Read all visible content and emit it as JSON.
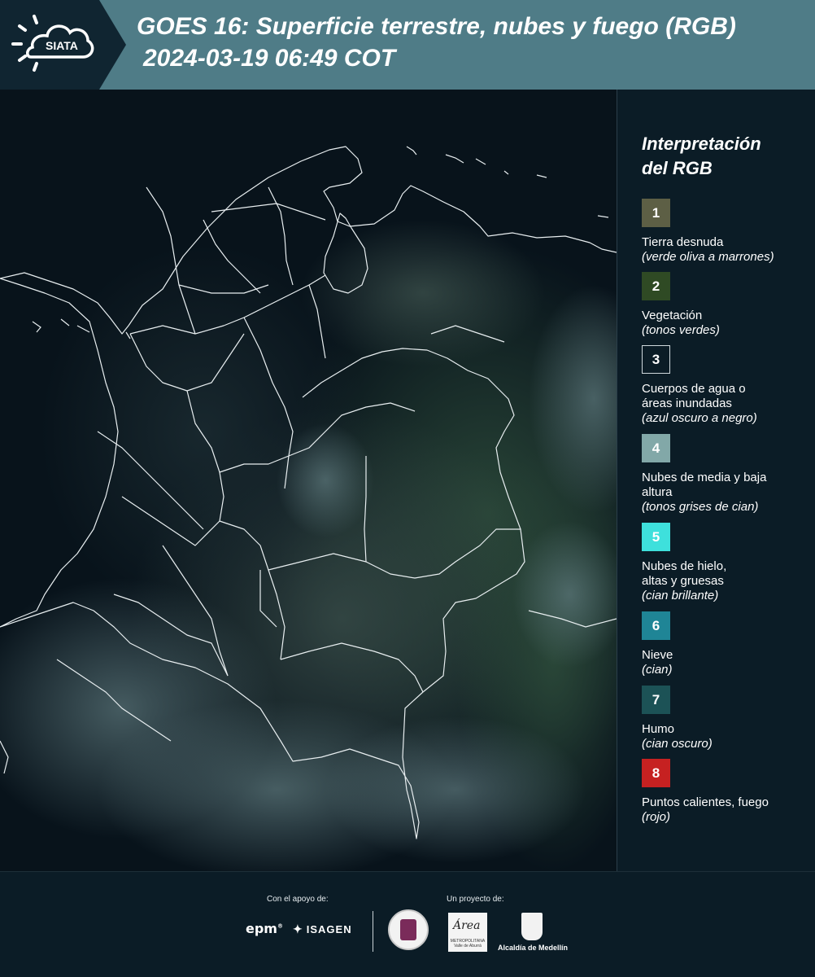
{
  "header": {
    "title_line1": "GOES 16: Superficie terrestre, nubes y fuego (RGB)",
    "title_line2": "2024-03-19 06:49 COT",
    "logo_text": "SIATA",
    "bg_color": "#4f7c87",
    "logo_bg_color": "#102531"
  },
  "legend": {
    "title_line1": "Interpretación",
    "title_line2": "del RGB",
    "items": [
      {
        "number": "1",
        "color": "#5d5f45",
        "label": "Tierra desnuda",
        "note": "(verde oliva a marrones)"
      },
      {
        "number": "2",
        "color": "#2f4a24",
        "label": "Vegetación",
        "note": "(tonos verdes)"
      },
      {
        "number": "3",
        "color": "#0b1c26",
        "label": "Cuerpos de agua o áreas inundadas",
        "note": "(azul oscuro a negro)"
      },
      {
        "number": "4",
        "color": "#82a8a8",
        "label": "Nubes de media y baja altura",
        "note": "(tonos grises de cian)"
      },
      {
        "number": "5",
        "color": "#3ee0dc",
        "label": "Nubes de hielo, altas y gruesas",
        "note": "(cian brillante)"
      },
      {
        "number": "6",
        "color": "#1f8596",
        "label": "Nieve",
        "note": "(cian)"
      },
      {
        "number": "7",
        "color": "#1c5256",
        "label": "Humo",
        "note": "(cian oscuro)"
      },
      {
        "number": "8",
        "color": "#c62121",
        "label": "Puntos calientes, fuego",
        "note": "(rojo)"
      }
    ]
  },
  "footer": {
    "support_label": "Con el apoyo de:",
    "project_label": "Un proyecto de:",
    "epm": "epm",
    "isagen": "ISAGEN",
    "area_script": "Área",
    "area_small": "METROPOLITANA Valle de Aburrá",
    "alcaldia": "Alcaldía de Medellín"
  }
}
